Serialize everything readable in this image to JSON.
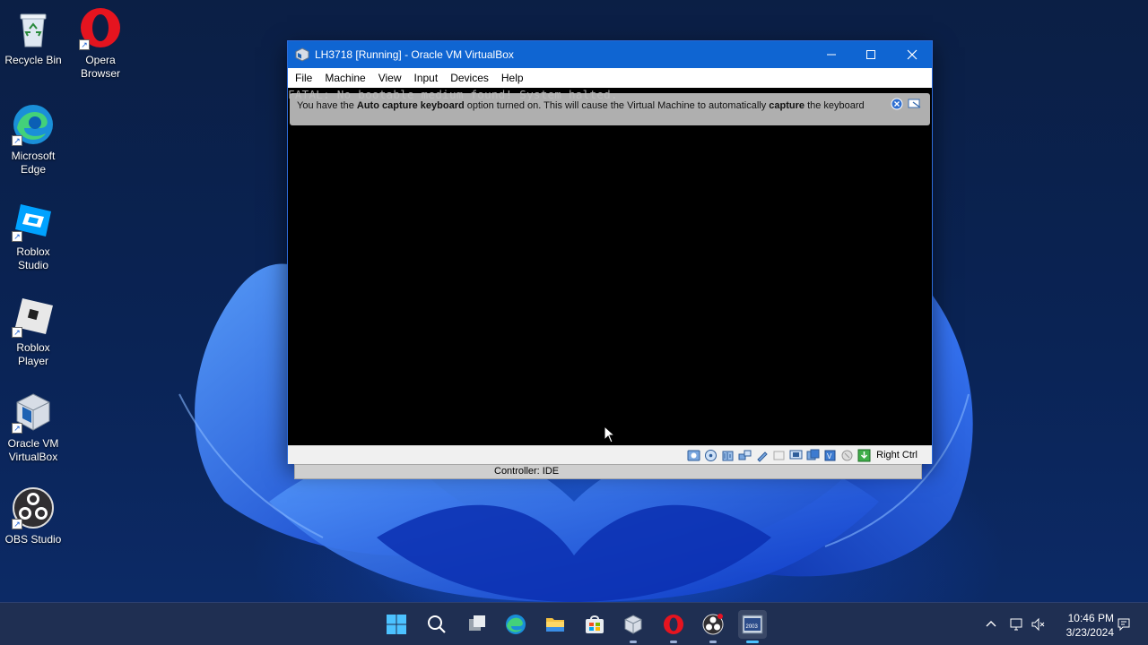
{
  "desktop": {
    "icons": [
      {
        "label": "Recycle Bin",
        "icon": "recycle-bin-icon"
      },
      {
        "label": "Opera Browser",
        "icon": "opera-icon"
      },
      {
        "label": "Microsoft Edge",
        "icon": "edge-icon"
      },
      {
        "label": "Roblox Studio",
        "icon": "roblox-studio-icon"
      },
      {
        "label": "Roblox Player",
        "icon": "roblox-player-icon"
      },
      {
        "label": "Oracle VM VirtualBox",
        "icon": "virtualbox-icon"
      },
      {
        "label": "OBS Studio",
        "icon": "obs-icon"
      }
    ]
  },
  "window": {
    "title": "LH3718 [Running] - Oracle VM VirtualBox",
    "menu": [
      "File",
      "Machine",
      "View",
      "Input",
      "Devices",
      "Help"
    ],
    "console_text": "FATAL: No bootable medium found! System halted.",
    "notice": {
      "part1": "You have the ",
      "bold1": "Auto capture keyboard",
      "part2": " option turned on. This will cause the Virtual Machine to automatically ",
      "bold2": "capture",
      "part3": " the keyboard"
    },
    "host_key": "Right Ctrl",
    "tooltip": "Controller: IDE"
  },
  "taskbar": {
    "apps": [
      "start-icon",
      "search-icon",
      "task-view-icon",
      "edge-icon",
      "file-explorer-icon",
      "store-icon",
      "virtualbox-icon",
      "opera-icon",
      "obs-icon",
      "app-2003-icon"
    ],
    "app_badge": "2003",
    "clock": {
      "time": "10:46 PM",
      "date": "3/23/2024"
    }
  },
  "colors": {
    "titlebar": "#0f65d2",
    "desktop": "#0a2354",
    "taskbar": "#1f2f52"
  }
}
